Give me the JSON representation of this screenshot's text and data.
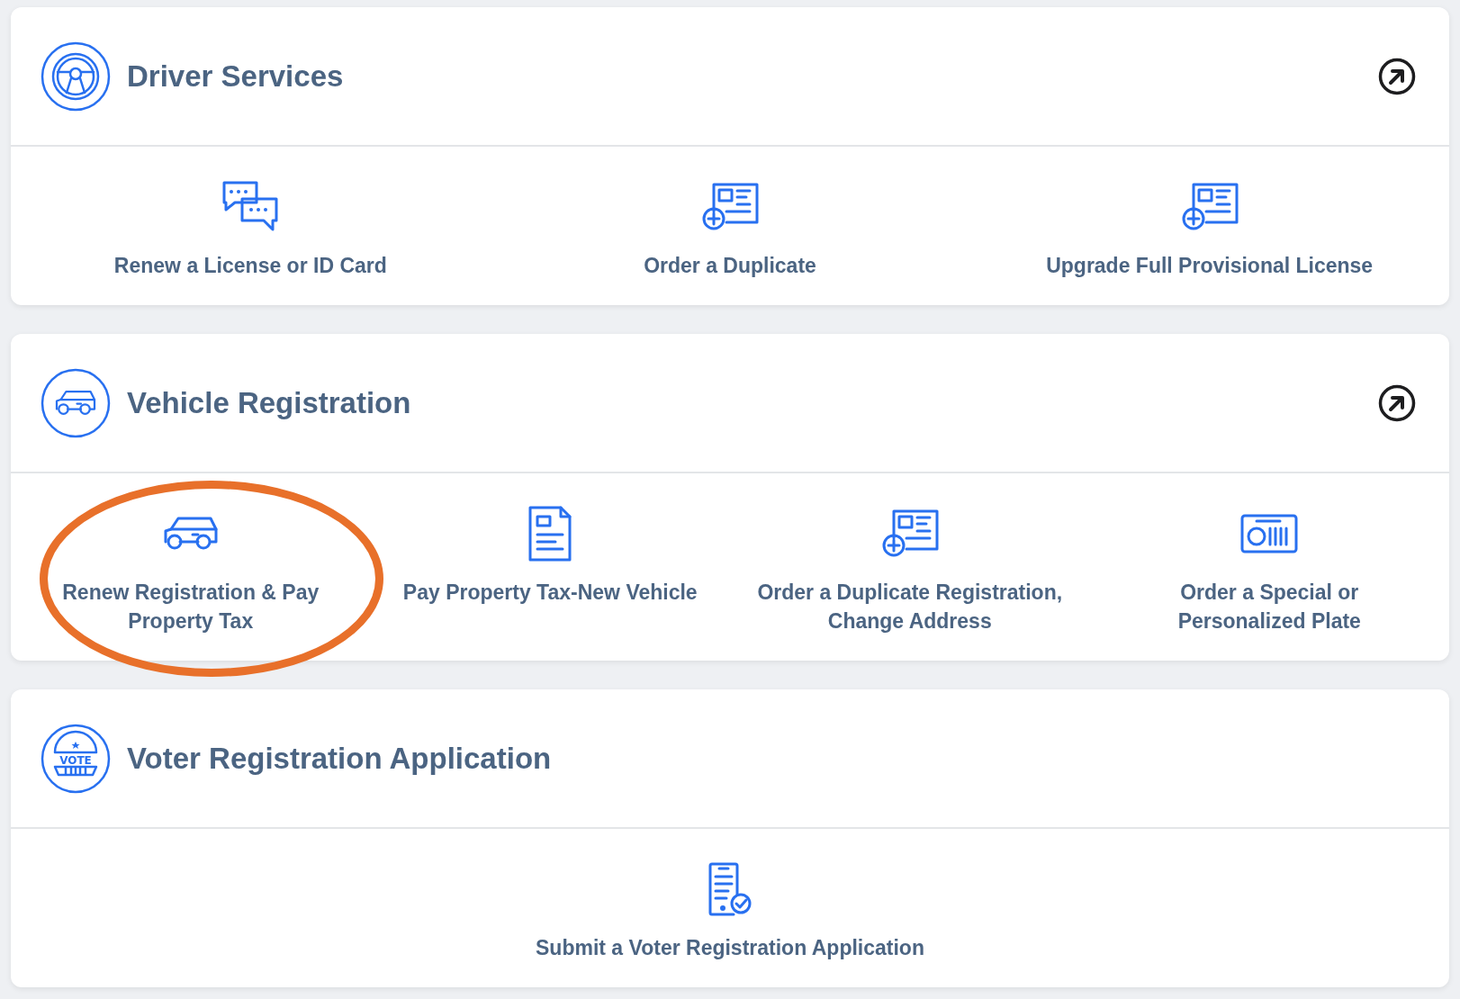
{
  "sections": [
    {
      "title": "Driver Services",
      "kind": "wheel",
      "external_link": true,
      "items": [
        {
          "label": "Renew a License or ID Card",
          "kind": "chat",
          "circled": false
        },
        {
          "label": "Order a Duplicate",
          "kind": "idcard",
          "circled": false
        },
        {
          "label": "Upgrade Full Provisional License",
          "kind": "idcard",
          "circled": false
        }
      ]
    },
    {
      "title": "Vehicle Registration",
      "kind": "car",
      "external_link": true,
      "items": [
        {
          "label": "Renew Registration & Pay Property Tax",
          "kind": "car",
          "circled": true
        },
        {
          "label": "Pay Property Tax-New Vehicle",
          "kind": "document",
          "circled": false
        },
        {
          "label": "Order a Duplicate Registration, Change Address",
          "kind": "idcard",
          "circled": false
        },
        {
          "label": "Order a Special or Personalized Plate",
          "kind": "plate",
          "circled": false
        }
      ]
    },
    {
      "title": "Voter Registration Application",
      "kind": "vote",
      "icon_text": "VOTE",
      "items": [
        {
          "label": "Submit a Voter Registration Application",
          "kind": "phone"
        }
      ]
    }
  ]
}
